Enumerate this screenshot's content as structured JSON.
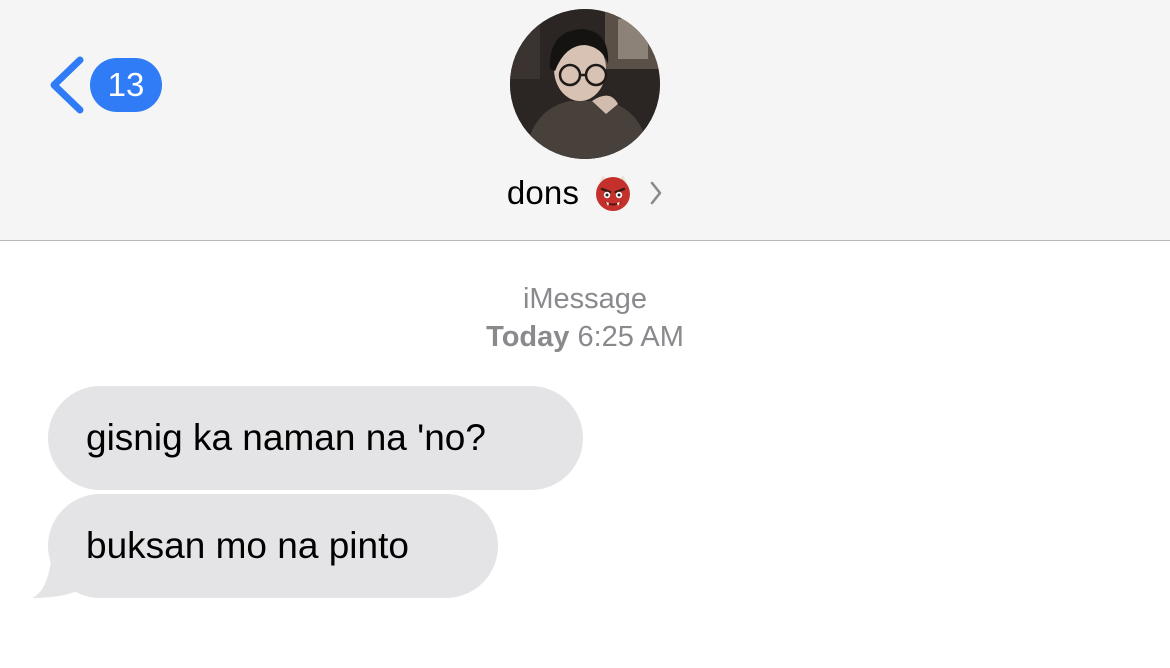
{
  "nav": {
    "back_count": "13",
    "back_icon": "chevron-left-icon",
    "accent_color": "#2f7cf6"
  },
  "contact": {
    "name": "dons",
    "emoji_icon": "ogre-emoji-icon",
    "chevron_icon": "chevron-right-icon"
  },
  "conversation": {
    "service": "iMessage",
    "timestamp_day": "Today",
    "timestamp_time": "6:25 AM",
    "messages": [
      {
        "direction": "incoming",
        "text": "gisnig ka naman na 'no?"
      },
      {
        "direction": "incoming",
        "text": "buksan mo na pinto"
      }
    ],
    "incoming_bubble_color": "#e4e4e6"
  }
}
